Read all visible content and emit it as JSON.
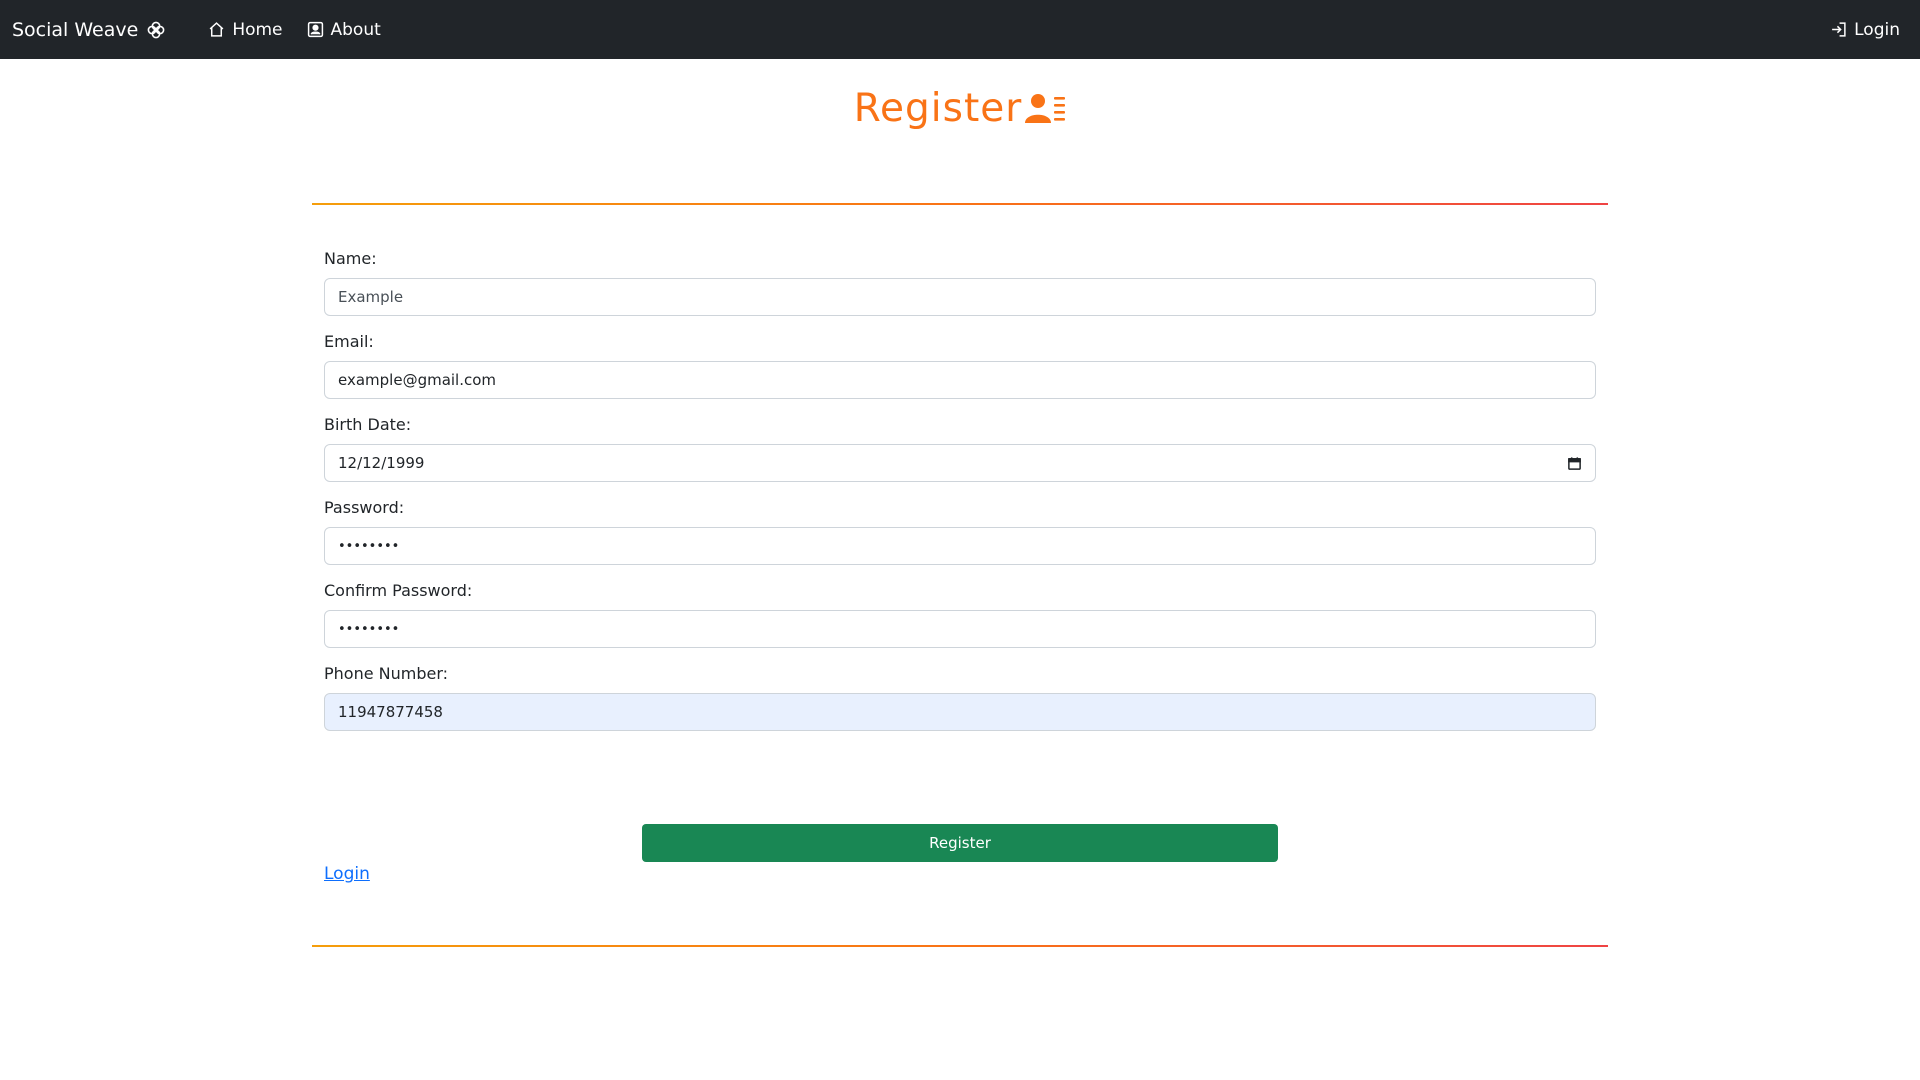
{
  "navbar": {
    "brand": "Social Weave",
    "brand_icon": "flower-icon",
    "links": [
      {
        "label": "Home",
        "icon": "home-icon"
      },
      {
        "label": "About",
        "icon": "about-icon"
      }
    ],
    "login": {
      "label": "Login",
      "icon": "login-icon"
    }
  },
  "page": {
    "title": "Register",
    "title_icon": "user-list-icon",
    "accent_color": "#f97316"
  },
  "form": {
    "name": {
      "label": "Name:",
      "value": "Example"
    },
    "email": {
      "label": "Email:",
      "value": "example@gmail.com"
    },
    "birth_date": {
      "label": "Birth Date:",
      "value": "12/12/1999",
      "icon": "calendar-icon"
    },
    "password": {
      "label": "Password:",
      "value": "••••••••"
    },
    "confirm_password": {
      "label": "Confirm Password:",
      "value": "••••••••"
    },
    "phone": {
      "label": "Phone Number:",
      "value": "11947877458"
    },
    "submit_label": "Register",
    "submit_color": "#198754",
    "login_link": "Login"
  }
}
